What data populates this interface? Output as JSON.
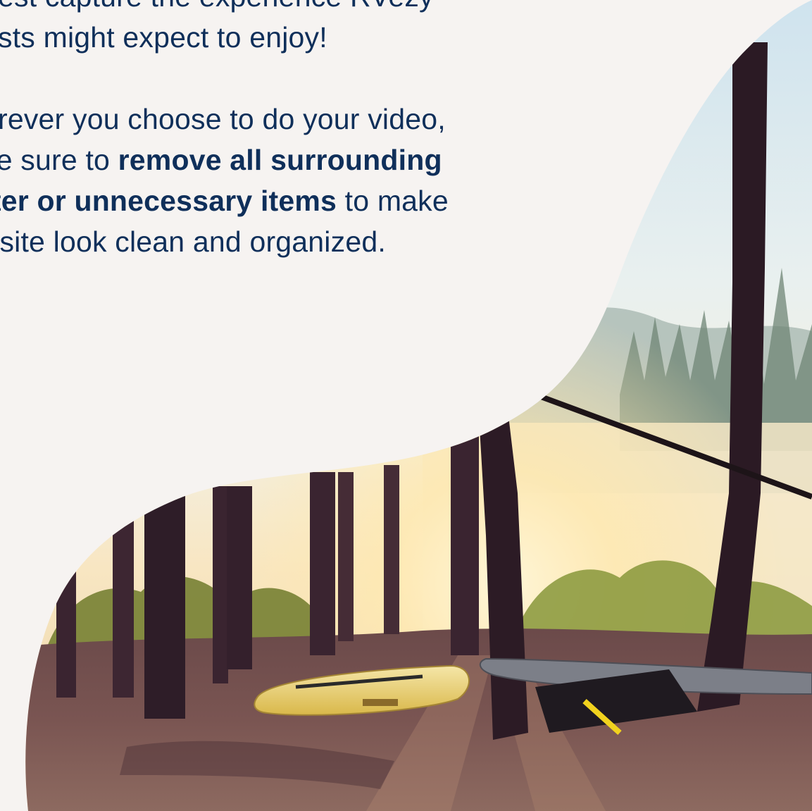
{
  "text": {
    "para1_line1": "best capture the experience RVezy",
    "para1_line2": "ests might expect to enjoy!",
    "para2_line1": "erever you choose to do your video,",
    "para2_line2_pre": "ke sure to ",
    "para2_line2_bold": "remove all surrounding",
    "para2_line3_bold": "tter or unnecessary items",
    "para2_line3_post": " to make",
    "para2_line4": "r site look clean and organized."
  },
  "colors": {
    "background": "#f6f3f1",
    "text": "#0f2f5a"
  },
  "photo": {
    "description_icon": "campsite-photo"
  }
}
